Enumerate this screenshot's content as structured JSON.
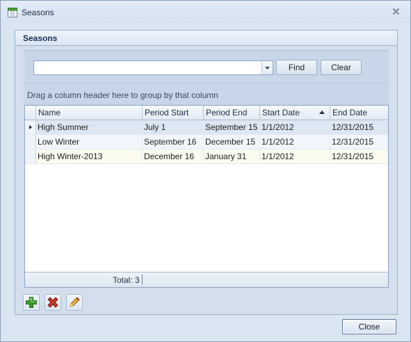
{
  "window": {
    "title": "Seasons"
  },
  "group": {
    "title": "Seasons"
  },
  "search": {
    "value": "",
    "placeholder": "",
    "find_label": "Find",
    "clear_label": "Clear"
  },
  "grid": {
    "group_hint": "Drag a column header here to group by that column",
    "columns": [
      "Name",
      "Period Start",
      "Period End",
      "Start Date",
      "End Date"
    ],
    "sorted_column": "Start Date",
    "sort_direction": "ascending",
    "rows": [
      {
        "name": "High Summer",
        "period_start": "July 1",
        "period_end": "September 15",
        "start_date": "1/1/2012",
        "end_date": "12/31/2015",
        "current": true
      },
      {
        "name": "Low Winter",
        "period_start": "September 16",
        "period_end": "December 15",
        "start_date": "1/1/2012",
        "end_date": "12/31/2015",
        "current": false
      },
      {
        "name": "High Winter-2013",
        "period_start": "December 16",
        "period_end": "January 31",
        "start_date": "1/1/2012",
        "end_date": "12/31/2015",
        "current": false
      }
    ],
    "footer_total": "Total: 3"
  },
  "actions": {
    "add_icon": "plus-icon",
    "delete_icon": "delete-x-icon",
    "edit_icon": "pencil-icon"
  },
  "close_label": "Close",
  "colors": {
    "add_green": "#3c9a2e",
    "delete_red": "#c0392b",
    "accent_blue": "#15325a"
  }
}
